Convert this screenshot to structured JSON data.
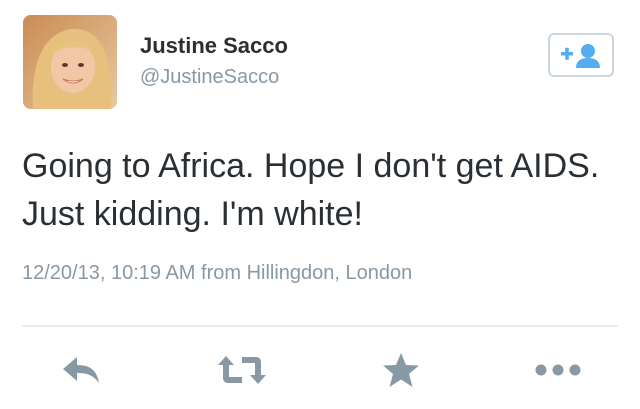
{
  "user": {
    "name": "Justine Sacco",
    "handle": "@JustineSacco"
  },
  "tweet": {
    "text": "Going to Africa. Hope I don't get AIDS. Just kidding. I'm white!",
    "meta": "12/20/13, 10:19 AM from Hillingdon, London"
  },
  "icons": {
    "follow": "follow-user-icon",
    "reply": "reply-icon",
    "retweet": "retweet-icon",
    "favorite": "star-icon",
    "more": "more-icon"
  },
  "colors": {
    "accent": "#55acee",
    "icon_gray": "#8899a6",
    "text": "#292f33",
    "divider": "#e6ecf0"
  }
}
